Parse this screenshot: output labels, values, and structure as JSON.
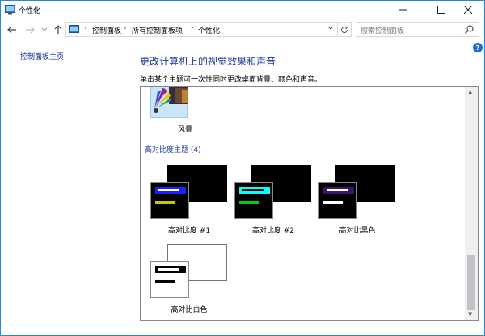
{
  "window": {
    "title": "个性化"
  },
  "address": {
    "crumbs": [
      "控制面板",
      "所有控制面板项",
      "个性化"
    ],
    "search_placeholder": "搜索控制面板"
  },
  "leftnav": {
    "home_link": "控制面板主页"
  },
  "help": {
    "label": "?"
  },
  "main": {
    "heading": "更改计算机上的视觉效果和声音",
    "subtext": "单击某个主题可一次性同时更改桌面背景、颜色和声音。",
    "themes_partial": {
      "label": "风景"
    },
    "high_contrast_group": {
      "title": "高对比度主题 (4)",
      "themes": [
        {
          "label": "高对比度 #1",
          "back_color": "#000000",
          "front_bg": "#000000",
          "bar_color": "#1a20ff",
          "line1_color": "#ffffff",
          "line2_color": "#c8c800"
        },
        {
          "label": "高对比度 #2",
          "back_color": "#000000",
          "front_bg": "#000000",
          "bar_color": "#00ffff",
          "line1_color": "#000000",
          "line2_color": "#00d000"
        },
        {
          "label": "高对比黑色",
          "back_color": "#000000",
          "front_bg": "#000000",
          "bar_color": "#3c1470",
          "line1_color": "#ffffff",
          "line2_color": "#ffffff"
        },
        {
          "label": "高对比白色",
          "back_color": "#ffffff",
          "front_bg": "#ffffff",
          "bar_color": "#000000",
          "line1_color": "#ffffff",
          "line2_color": "#000000"
        }
      ]
    }
  }
}
